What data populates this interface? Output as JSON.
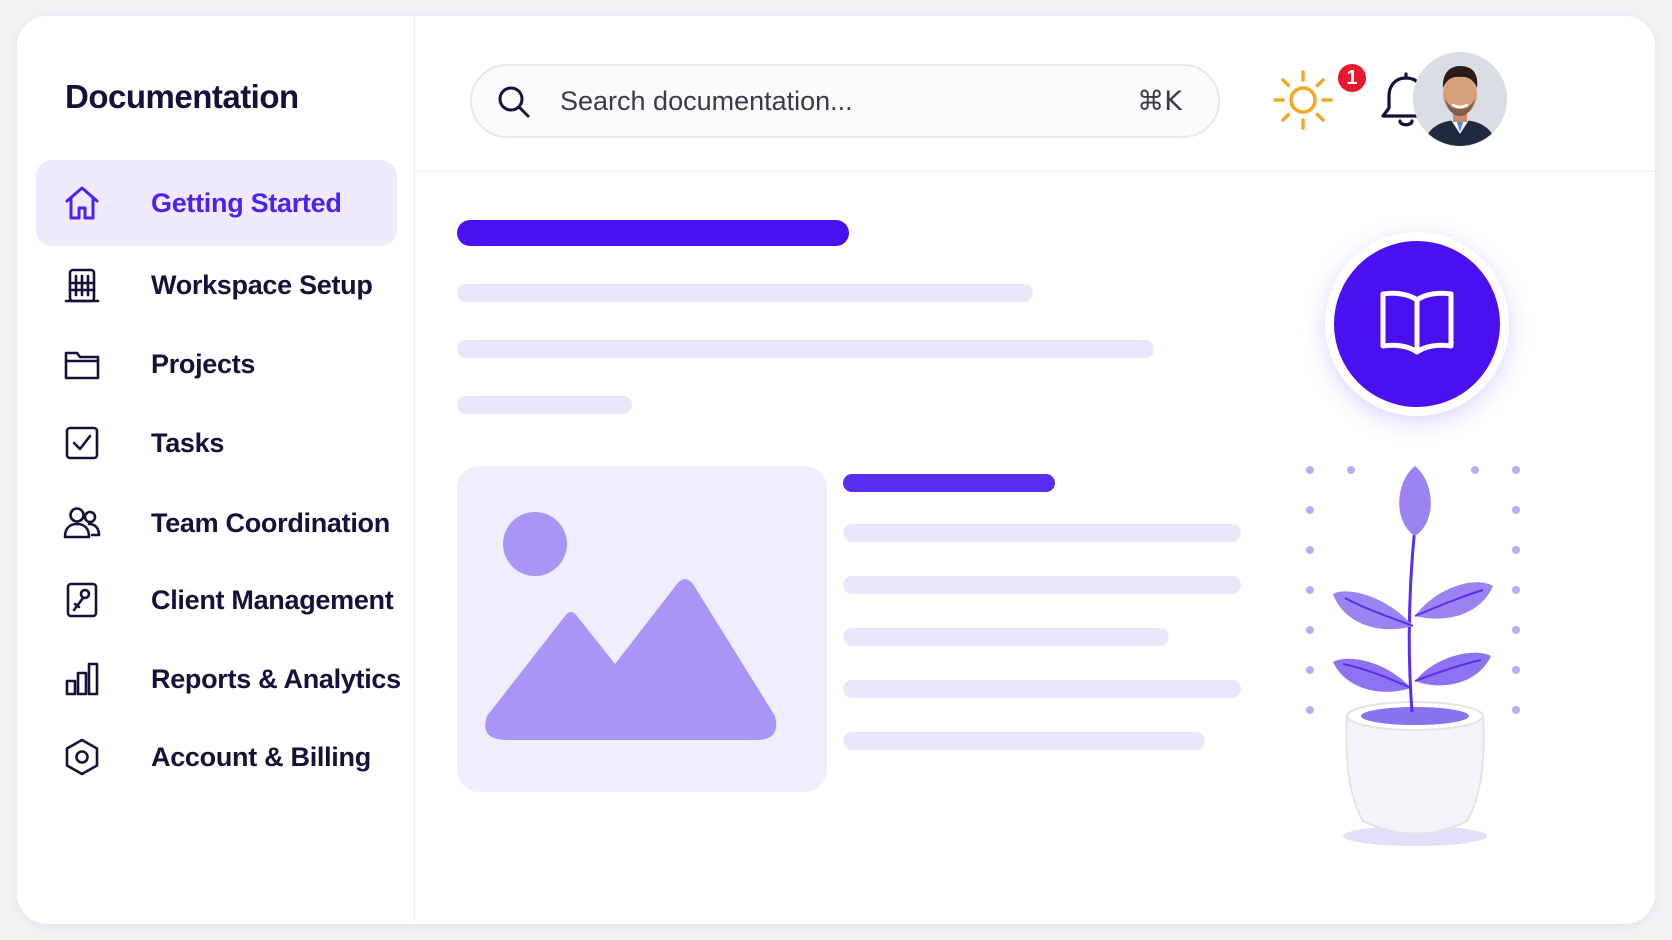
{
  "brand": {
    "title": "Documentation"
  },
  "sidebar": {
    "items": [
      {
        "label": "Getting Started",
        "icon": "home-icon",
        "active": true
      },
      {
        "label": "Workspace Setup",
        "icon": "building-icon",
        "active": false
      },
      {
        "label": "Projects",
        "icon": "folder-icon",
        "active": false
      },
      {
        "label": "Tasks",
        "icon": "checkbox-icon",
        "active": false
      },
      {
        "label": "Team Coordination",
        "icon": "users-icon",
        "active": false
      },
      {
        "label": "Client Management",
        "icon": "client-file-icon",
        "active": false
      },
      {
        "label": "Reports & Analytics",
        "icon": "bar-chart-icon",
        "active": false
      },
      {
        "label": "Account & Billing",
        "icon": "hexagon-settings-icon",
        "active": false
      }
    ]
  },
  "header": {
    "search": {
      "placeholder": "Search documentation...",
      "shortcut": "⌘K"
    },
    "notifications": {
      "count": "1"
    },
    "theme_icon": "sun-icon",
    "bell_icon": "bell-icon",
    "avatar": "user-avatar"
  },
  "colors": {
    "accent": "#4b22f0",
    "accent_dark": "#4b10ef",
    "active_bg": "#efebfd",
    "skeleton": "#ebe7fb",
    "sun": "#f5a623",
    "badge": "#e8192c",
    "text": "#14123a"
  }
}
